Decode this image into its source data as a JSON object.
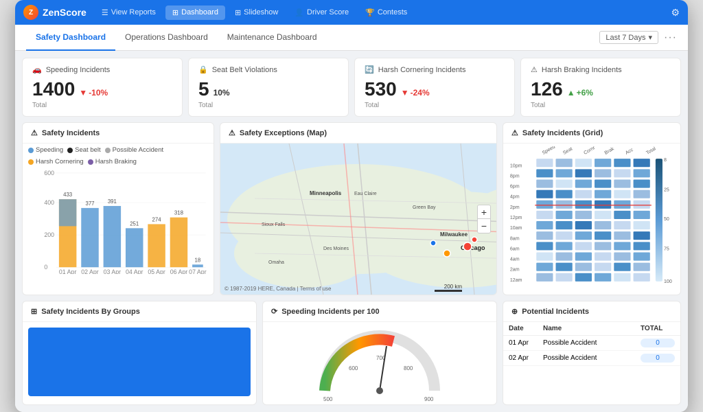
{
  "app": {
    "name": "ZenScore",
    "nav_items": [
      {
        "label": "View Reports",
        "icon": "📋",
        "active": false
      },
      {
        "label": "Dashboard",
        "icon": "⊞",
        "active": true
      },
      {
        "label": "Slideshow",
        "icon": "⊞",
        "active": false
      },
      {
        "label": "Driver Score",
        "icon": "👤",
        "active": false
      },
      {
        "label": "Contests",
        "icon": "🏆",
        "active": false
      }
    ]
  },
  "sub_tabs": [
    {
      "label": "Safety Dashboard",
      "active": true
    },
    {
      "label": "Operations Dashboard",
      "active": false
    },
    {
      "label": "Maintenance Dashboard",
      "active": false
    }
  ],
  "date_range": "Last 7 Days",
  "stat_cards": [
    {
      "icon": "🚗",
      "title": "Speeding Incidents",
      "value": "1400",
      "change": "-10%",
      "change_dir": "down",
      "label": "Total"
    },
    {
      "icon": "🔒",
      "title": "Seat Belt Violations",
      "value": "5",
      "change": "10%",
      "change_dir": "neutral",
      "label": "Total"
    },
    {
      "icon": "🔄",
      "title": "Harsh Cornering Incidents",
      "value": "530",
      "change": "-24%",
      "change_dir": "down",
      "label": "Total"
    },
    {
      "icon": "⚠",
      "title": "Harsh Braking Incidents",
      "value": "126",
      "change": "+6%",
      "change_dir": "up",
      "label": "Total"
    }
  ],
  "safety_incidents_panel": {
    "title": "Safety Incidents",
    "legend": [
      {
        "label": "Speeding",
        "color": "#5b9bd5"
      },
      {
        "label": "Seat belt",
        "color": "#222"
      },
      {
        "label": "Possible Accident",
        "color": "#aaa"
      },
      {
        "label": "Harsh Cornering",
        "color": "#f5a623"
      },
      {
        "label": "Harsh Braking",
        "color": "#7b5ea7"
      }
    ],
    "bars": [
      {
        "date": "01 Apr",
        "value": 433,
        "color": "#f5a623"
      },
      {
        "date": "02 Apr",
        "value": 377,
        "color": "#5b9bd5"
      },
      {
        "date": "03 Apr",
        "value": 391,
        "color": "#5b9bd5"
      },
      {
        "date": "04 Apr",
        "value": 251,
        "color": "#5b9bd5"
      },
      {
        "date": "05 Apr",
        "value": 274,
        "color": "#f5a623"
      },
      {
        "date": "06 Apr",
        "value": 318,
        "color": "#f5a623"
      },
      {
        "date": "07 Apr",
        "value": 18,
        "color": "#5b9bd5"
      }
    ],
    "y_max": 600,
    "y_labels": [
      "0",
      "200",
      "400",
      "600"
    ]
  },
  "map_panel": {
    "title": "Safety Exceptions (Map)",
    "copyright": "© 1987-2019 HERE, Canada | Terms of use"
  },
  "grid_panel": {
    "title": "Safety Incidents (Grid)",
    "col_labels": [
      "",
      "Speed",
      "Seat",
      "Cornr",
      "Brak",
      "Acc",
      "Total"
    ],
    "row_labels": [
      "10pm",
      "8pm",
      "6pm",
      "4pm",
      "2pm",
      "12pm",
      "10am",
      "8am",
      "6am",
      "4am",
      "2am",
      "12am"
    ],
    "scale_labels": [
      "0",
      "25",
      "50",
      "75",
      "100"
    ]
  },
  "groups_panel": {
    "title": "Safety Incidents By Groups"
  },
  "speeding_panel": {
    "title": "Speeding Incidents per 100",
    "gauge_labels": [
      "500",
      "600",
      "700",
      "800",
      "900"
    ]
  },
  "potential_panel": {
    "title": "Potential Incidents",
    "columns": [
      "Date",
      "Name",
      "TOTAL"
    ],
    "rows": [
      {
        "date": "01 Apr",
        "name": "Possible Accident",
        "total": "0"
      },
      {
        "date": "02 Apr",
        "name": "Possible Accident",
        "total": "0"
      }
    ]
  }
}
